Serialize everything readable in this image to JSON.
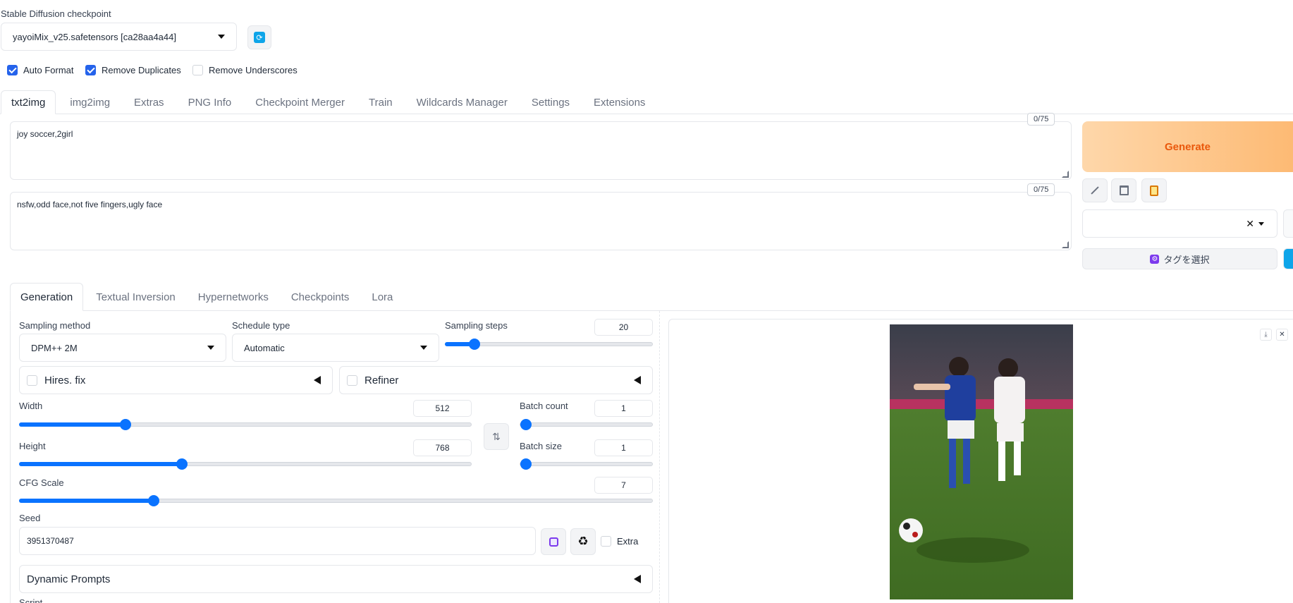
{
  "checkpoint": {
    "label": "Stable Diffusion checkpoint",
    "value": "yayoiMix_v25.safetensors [ca28aa4a44]"
  },
  "options": [
    {
      "label": "Auto Format",
      "checked": true
    },
    {
      "label": "Remove Duplicates",
      "checked": true
    },
    {
      "label": "Remove Underscores",
      "checked": false
    }
  ],
  "main_tabs": [
    "txt2img",
    "img2img",
    "Extras",
    "PNG Info",
    "Checkpoint Merger",
    "Train",
    "Wildcards Manager",
    "Settings",
    "Extensions"
  ],
  "prompt": {
    "text": "joy soccer,2girl",
    "counter": "0/75"
  },
  "negative_prompt": {
    "text": "nsfw,odd face,not five fingers,ugly face",
    "counter": "0/75"
  },
  "generate_label": "Generate",
  "tag_select_label": "タグを選択",
  "sub_tabs": [
    "Generation",
    "Textual Inversion",
    "Hypernetworks",
    "Checkpoints",
    "Lora"
  ],
  "sampling_method": {
    "label": "Sampling method",
    "value": "DPM++ 2M"
  },
  "schedule_type": {
    "label": "Schedule type",
    "value": "Automatic"
  },
  "sampling_steps": {
    "label": "Sampling steps",
    "value": "20",
    "fraction": 0.14
  },
  "hires_fix": {
    "label": "Hires. fix",
    "checked": false
  },
  "refiner": {
    "label": "Refiner",
    "checked": false
  },
  "width": {
    "label": "Width",
    "value": "512",
    "fraction": 0.235
  },
  "height": {
    "label": "Height",
    "value": "768",
    "fraction": 0.36
  },
  "batch_count": {
    "label": "Batch count",
    "value": "1",
    "fraction": 0.0
  },
  "batch_size": {
    "label": "Batch size",
    "value": "1",
    "fraction": 0.0
  },
  "cfg_scale": {
    "label": "CFG Scale",
    "value": "7",
    "fraction": 0.212
  },
  "seed": {
    "label": "Seed",
    "value": "3951370487"
  },
  "extra_label": "Extra",
  "dynamic_prompts_label": "Dynamic Prompts",
  "script_label": "Script",
  "colors": {
    "accent": "#0a73ff",
    "generate_text": "#ea580c",
    "generate_bg_start": "#fed7aa",
    "generate_bg_end": "#fdba74"
  }
}
